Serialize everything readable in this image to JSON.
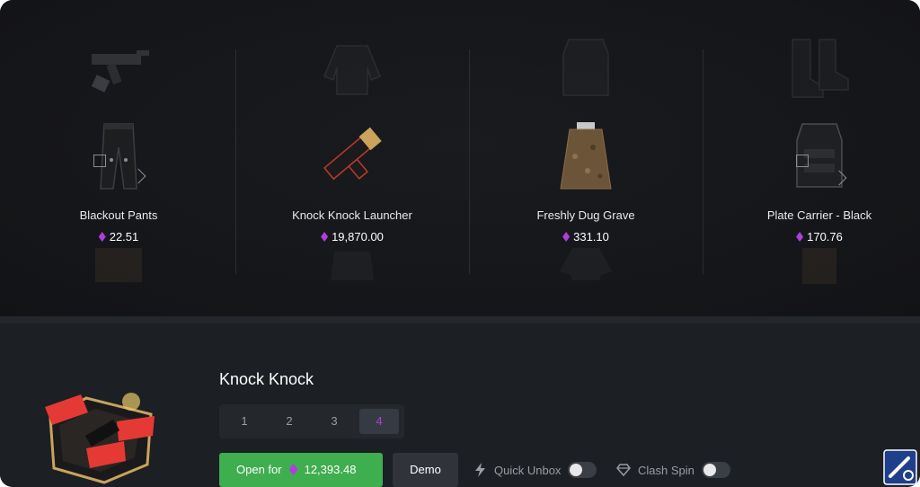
{
  "reel": {
    "items": [
      {
        "name": "Blackout Pants",
        "price": "22.51",
        "icon": "blackout-pants-image"
      },
      {
        "name": "Knock Knock Launcher",
        "price": "19,870.00",
        "icon": "knock-knock-launcher-image"
      },
      {
        "name": "Freshly Dug Grave",
        "price": "331.10",
        "icon": "freshly-dug-grave-image"
      },
      {
        "name": "Plate Carrier - Black",
        "price": "170.76",
        "icon": "plate-carrier-image"
      }
    ]
  },
  "case": {
    "title": "Knock Knock",
    "image": "knock-knock-case-image",
    "tabs": [
      "1",
      "2",
      "3",
      "4"
    ],
    "active_tab": "4"
  },
  "actions": {
    "open_label": "Open for",
    "open_price": "12,393.48",
    "demo_label": "Demo",
    "quick_unbox_label": "Quick Unbox",
    "quick_unbox_on": false,
    "clash_spin_label": "Clash Spin",
    "clash_spin_on": false
  },
  "colors": {
    "accent_purple": "#b13ce0",
    "open_green": "#3fae4f",
    "background": "#1c1f24"
  }
}
